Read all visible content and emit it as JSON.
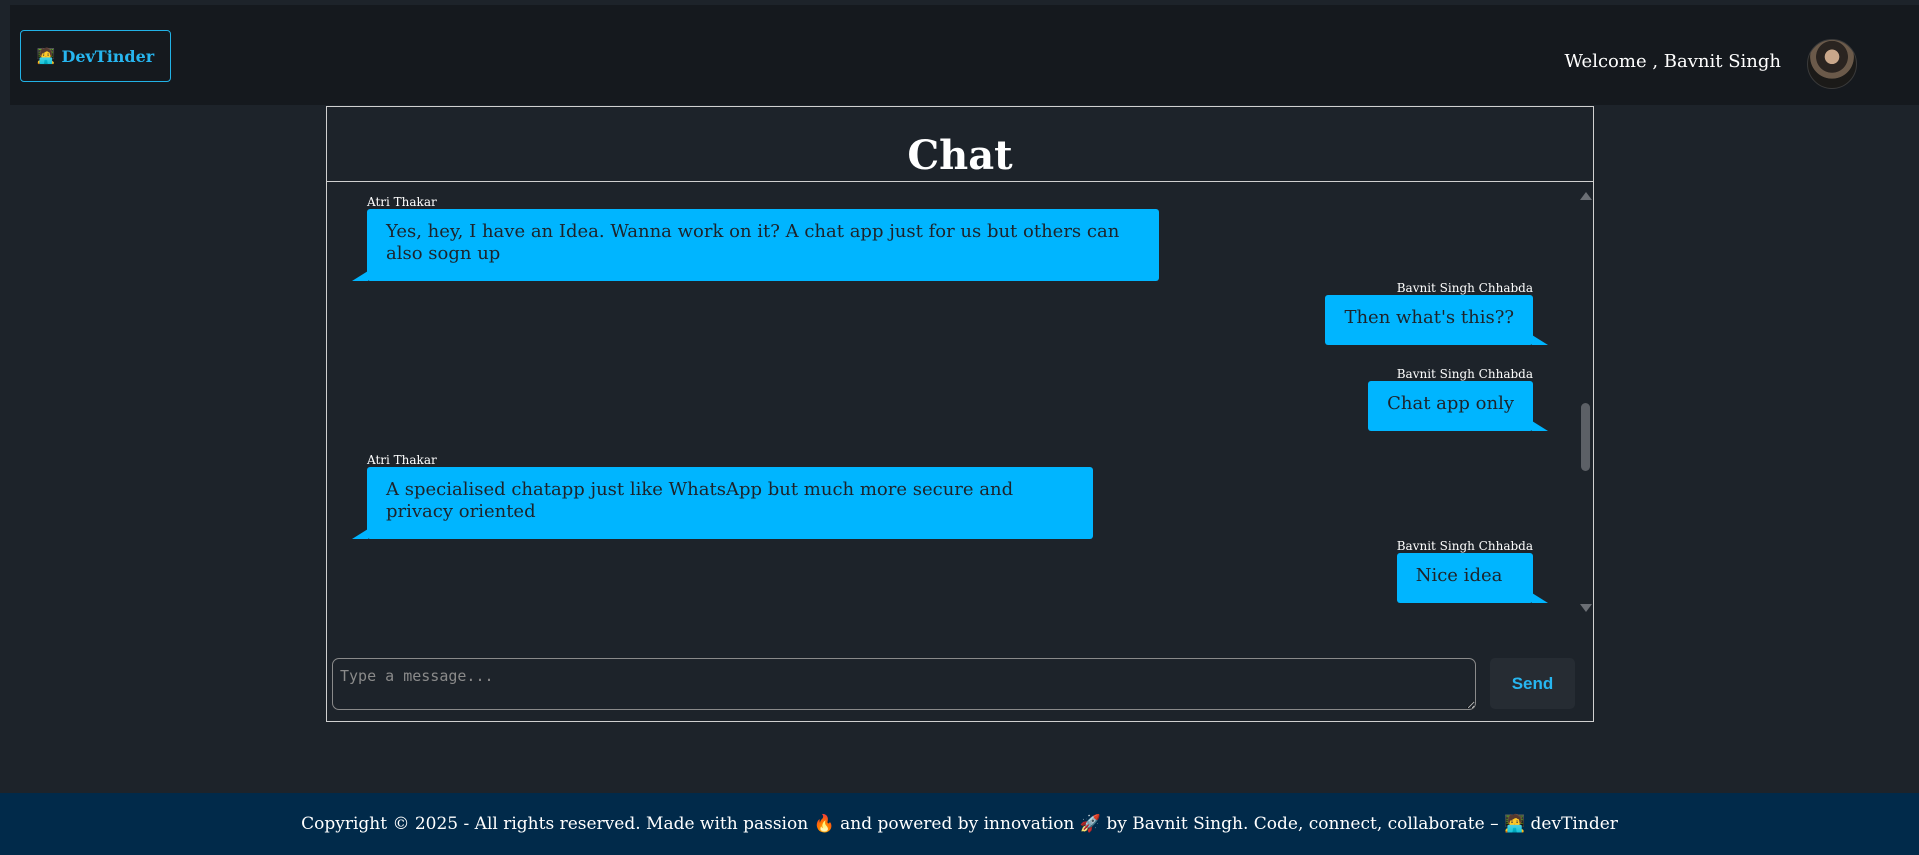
{
  "navbar": {
    "brand_icon": "🧑‍💻",
    "brand_label": "DevTinder",
    "welcome_text": "Welcome , Bavnit Singh",
    "avatar_alt": "user avatar"
  },
  "chat": {
    "title": "Chat",
    "messages": [
      {
        "sender": "Atri Thakar",
        "text": "Yes, hey, I have an Idea. Wanna work on it? A chat app just for us but others can also sogn up",
        "side": "left"
      },
      {
        "sender": "Bavnit Singh Chhabda",
        "text": "Then what's this??",
        "side": "right"
      },
      {
        "sender": "Bavnit Singh Chhabda",
        "text": "Chat app only",
        "side": "right"
      },
      {
        "sender": "Atri Thakar",
        "text": "A specialised chatapp just like WhatsApp but much more secure and privacy oriented",
        "side": "left"
      },
      {
        "sender": "Bavnit Singh Chhabda",
        "text": "Nice idea",
        "side": "right"
      }
    ],
    "input_placeholder": "Type a message...",
    "send_label": "Send"
  },
  "footer": {
    "text": "Copyright © 2025 - All rights reserved. Made with passion 🔥 and powered by innovation 🚀 by Bavnit Singh. Code, connect, collaborate – 🧑‍💻 devTinder"
  },
  "colors": {
    "background": "#1d232a",
    "navbar": "#15191e",
    "accent": "#27b6f0",
    "bubble": "#00b5ff",
    "footer": "#012a4a"
  }
}
